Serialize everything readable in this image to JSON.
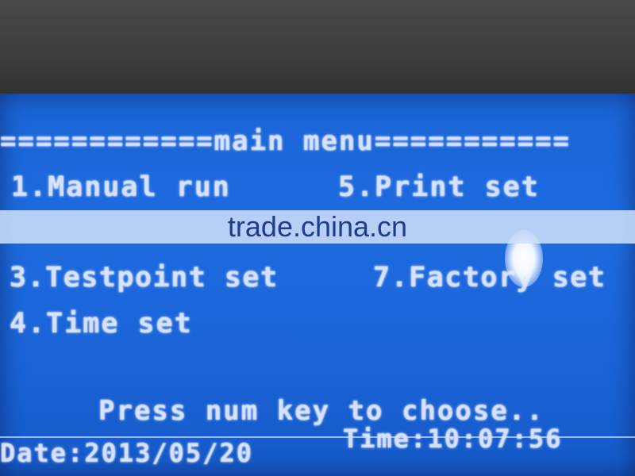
{
  "screen": {
    "title_line": "============main menu===========",
    "menu_items": [
      "1.Manual run",
      "5.Print set",
      "3.Testpoint set",
      "7.Factory set",
      "4.Time set"
    ],
    "prompt": "Press num key to choose..",
    "status": {
      "date": "Date:2013/05/20",
      "time": "Time:10:07:56"
    }
  },
  "watermark": "trade.china.cn",
  "colors": {
    "lcd_background": "#1d6be0",
    "lcd_text": "#d8e2ff",
    "bezel": "#2f322f"
  }
}
